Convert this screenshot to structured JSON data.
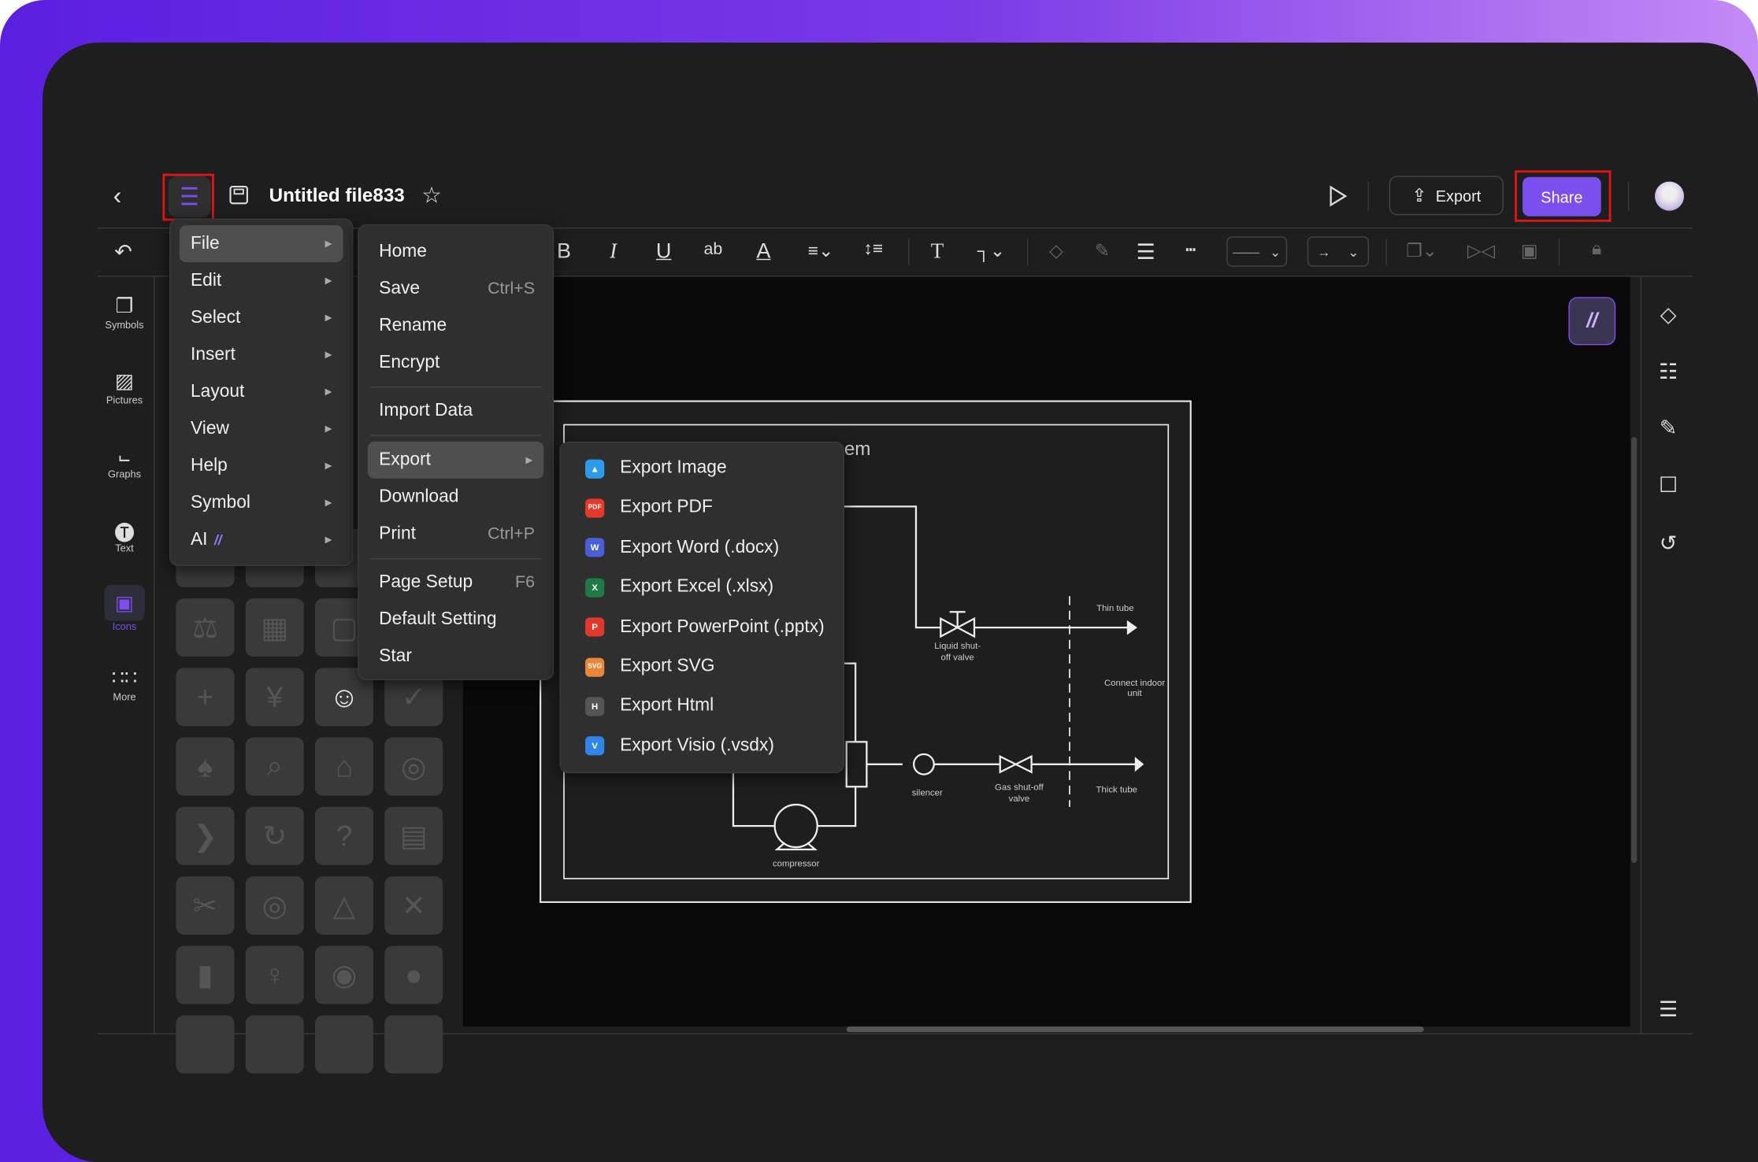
{
  "header": {
    "title": "Untitled file833",
    "export_label": "Export",
    "share_label": "Share"
  },
  "colors": {
    "accent": "#7b4fee",
    "highlight_box": "#e01515",
    "background_gradient": [
      "#5b1fe0",
      "#c48af5"
    ]
  },
  "toolbar": {
    "items": [
      "undo-icon",
      "bold-icon",
      "italic-icon",
      "underline-icon",
      "strikethrough-icon",
      "font-color-icon",
      "align-icon",
      "line-spacing-icon",
      "text-icon",
      "connector-icon",
      "fill-icon",
      "pen-icon",
      "line-weight-icon",
      "dash-icon",
      "line-style-select",
      "arrow-style-select",
      "arrange-icon",
      "flip-icon",
      "group-icon",
      "lock-icon"
    ]
  },
  "sidebar": {
    "items": [
      {
        "label": "Symbols",
        "icon": "symbols-icon"
      },
      {
        "label": "Pictures",
        "icon": "pictures-icon"
      },
      {
        "label": "Graphs",
        "icon": "graphs-icon"
      },
      {
        "label": "Text",
        "icon": "text-icon"
      },
      {
        "label": "Icons",
        "icon": "icons-icon",
        "active": true
      },
      {
        "label": "More",
        "icon": "more-icon"
      }
    ]
  },
  "main_menu": {
    "items": [
      {
        "label": "File",
        "highlighted": true
      },
      {
        "label": "Edit"
      },
      {
        "label": "Select"
      },
      {
        "label": "Insert"
      },
      {
        "label": "Layout"
      },
      {
        "label": "View"
      },
      {
        "label": "Help"
      },
      {
        "label": "Symbol"
      },
      {
        "label": "AI"
      }
    ]
  },
  "file_menu": {
    "items": [
      {
        "label": "Home"
      },
      {
        "label": "Save",
        "shortcut": "Ctrl+S"
      },
      {
        "label": "Rename"
      },
      {
        "label": "Encrypt"
      },
      {
        "label": "Import Data"
      },
      {
        "label": "Export",
        "highlighted": true
      },
      {
        "label": "Download"
      },
      {
        "label": "Print",
        "shortcut": "Ctrl+P"
      },
      {
        "label": "Page Setup",
        "shortcut": "F6"
      },
      {
        "label": "Default Setting"
      },
      {
        "label": "Star"
      }
    ]
  },
  "export_menu": {
    "items": [
      {
        "label": "Export Image",
        "badge": "",
        "color": "#2d9be8"
      },
      {
        "label": "Export PDF",
        "badge": "PDF",
        "color": "#e53a2a"
      },
      {
        "label": "Export Word (.docx)",
        "badge": "W",
        "color": "#4a5ed8"
      },
      {
        "label": "Export Excel (.xlsx)",
        "badge": "X",
        "color": "#1e7b45"
      },
      {
        "label": "Export PowerPoint (.pptx)",
        "badge": "P",
        "color": "#e0392b"
      },
      {
        "label": "Export SVG",
        "badge": "SVG",
        "color": "#e8873a"
      },
      {
        "label": "Export Html",
        "badge": "H",
        "color": "#555555"
      },
      {
        "label": "Export Visio (.vsdx)",
        "badge": "V",
        "color": "#2f86e8"
      }
    ]
  },
  "diagram": {
    "title_fragment": "em",
    "labels": {
      "thin_tube": "Thin tube",
      "liquid_valve_1": "Liquid shut-",
      "liquid_valve_2": "off valve",
      "indoor_1": "Connect indoor",
      "indoor_2": "unit",
      "silencer": "silencer",
      "gas_valve_1": "Gas shut-off",
      "gas_valve_2": "valve",
      "thick_tube": "Thick tube",
      "compressor": "compressor"
    }
  }
}
